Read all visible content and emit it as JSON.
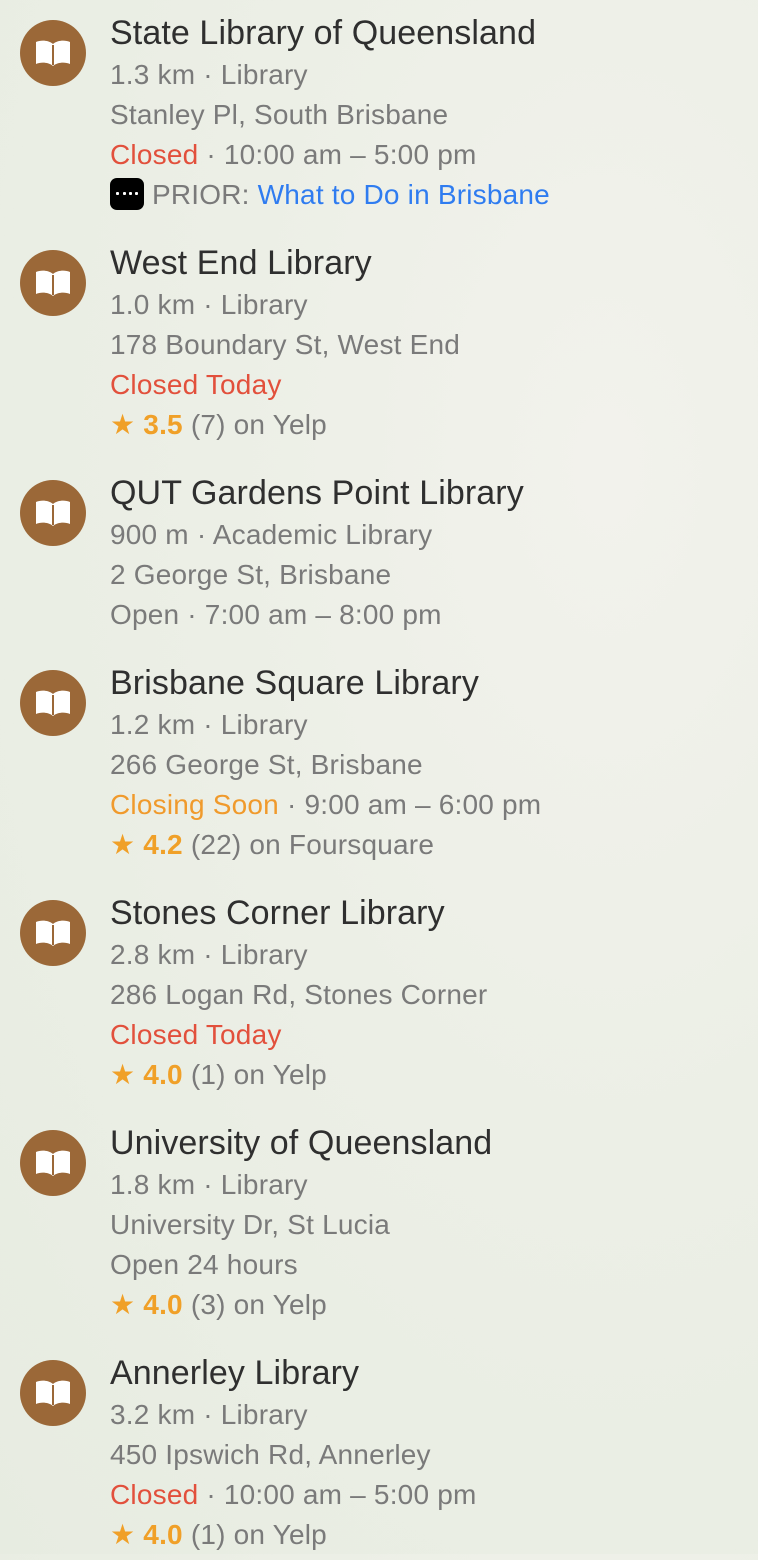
{
  "colors": {
    "icon_bg": "#9b6838",
    "closed": "#e2503c",
    "closing_soon": "#f09a2c",
    "rating": "#f0a028",
    "link": "#2f7cf0"
  },
  "separator": "·",
  "star": "★",
  "results": [
    {
      "name": "State Library of Queensland",
      "icon": "book-icon",
      "distance": "1.3 km",
      "category": "Library",
      "address": "Stanley Pl, South Brisbane",
      "status": "Closed",
      "hours": "10:00 am – 5:00 pm",
      "guide_prefix": "PRIOR:",
      "guide_link": "What to Do in Brisbane"
    },
    {
      "name": "West End Library",
      "icon": "book-icon",
      "distance": "1.0 km",
      "category": "Library",
      "address": "178 Boundary St, West End",
      "status": "Closed Today",
      "rating": "3.5",
      "review_count": "(7)",
      "source": "on Yelp"
    },
    {
      "name": "QUT Gardens Point Library",
      "icon": "book-icon",
      "distance": "900 m",
      "category": "Academic Library",
      "address": "2 George St, Brisbane",
      "status": "Open",
      "hours": "7:00 am – 8:00 pm"
    },
    {
      "name": "Brisbane Square Library",
      "icon": "book-icon",
      "distance": "1.2 km",
      "category": "Library",
      "address": "266 George St, Brisbane",
      "status": "Closing Soon",
      "hours": "9:00 am – 6:00 pm",
      "rating": "4.2",
      "review_count": "(22)",
      "source": "on Foursquare"
    },
    {
      "name": "Stones Corner Library",
      "icon": "book-icon",
      "distance": "2.8 km",
      "category": "Library",
      "address": "286 Logan Rd, Stones Corner",
      "status": "Closed Today",
      "rating": "4.0",
      "review_count": "(1)",
      "source": "on Yelp"
    },
    {
      "name": "University of Queensland",
      "icon": "book-icon",
      "distance": "1.8 km",
      "category": "Library",
      "address": "University Dr, St Lucia",
      "status": "Open 24 hours",
      "rating": "4.0",
      "review_count": "(3)",
      "source": "on Yelp"
    },
    {
      "name": "Annerley Library",
      "icon": "book-icon",
      "distance": "3.2 km",
      "category": "Library",
      "address": "450 Ipswich Rd, Annerley",
      "status": "Closed",
      "hours": "10:00 am – 5:00 pm",
      "rating": "4.0",
      "review_count": "(1)",
      "source": "on Yelp"
    }
  ]
}
